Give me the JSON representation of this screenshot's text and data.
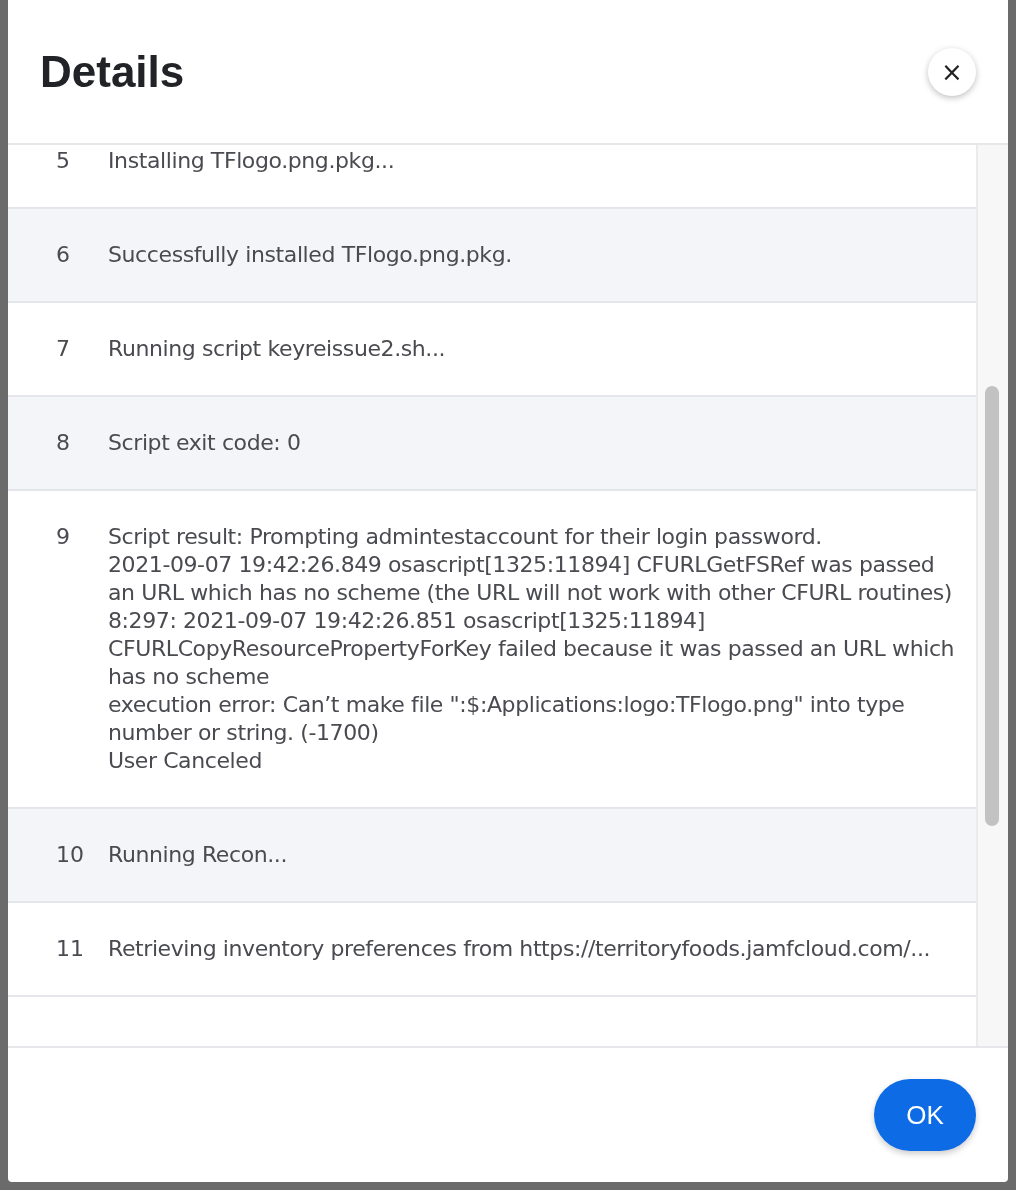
{
  "dialog": {
    "title": "Details",
    "close_label": "×"
  },
  "log": {
    "rows": [
      {
        "number": "5",
        "text": "Installing TFlogo.png.pkg..."
      },
      {
        "number": "6",
        "text": "Successfully installed TFlogo.png.pkg."
      },
      {
        "number": "7",
        "text": "Running script keyreissue2.sh..."
      },
      {
        "number": "8",
        "text": "Script exit code: 0"
      },
      {
        "number": "9",
        "text": "Script result: Prompting admintestaccount for their login password.\n2021-09-07 19:42:26.849 osascript[1325:11894] CFURLGetFSRef was passed an URL which has no scheme (the URL will not work with other CFURL routines)\n8:297: 2021-09-07 19:42:26.851 osascript[1325:11894] CFURLCopyResourcePropertyForKey failed because it was passed an URL which has no scheme\nexecution error: Can’t make file \":$:Applications:logo:TFlogo.png\" into type number or string. (-1700)\nUser Canceled"
      },
      {
        "number": "10",
        "text": "Running Recon..."
      },
      {
        "number": "11",
        "text": "Retrieving inventory preferences from https://territoryfoods.jamfcloud.com/..."
      }
    ]
  },
  "footer": {
    "ok_button": "OK"
  }
}
